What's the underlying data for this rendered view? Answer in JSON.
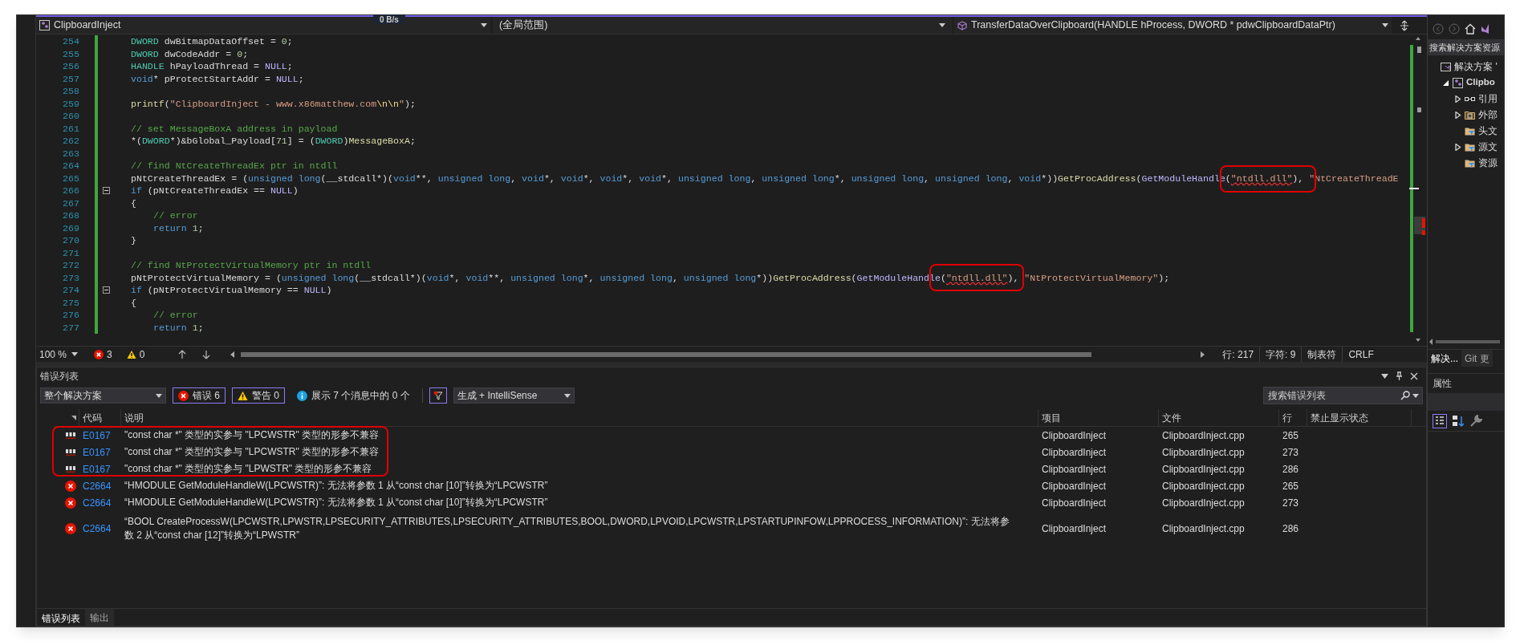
{
  "top_overlay": {
    "speed": "0 B/s"
  },
  "nav_bar": {
    "project": "ClipboardInject",
    "scope": "(全局范围)",
    "member": "TransferDataOverClipboard(HANDLE hProcess, DWORD * pdwClipboardDataPtr)"
  },
  "code_lines": [
    {
      "number": "254",
      "fold": false,
      "inner": false,
      "tokens": [
        {
          "text": "DWORD",
          "kind": "type"
        },
        {
          "text": " dwBitmapDataOffset = ",
          "kind": "plain"
        },
        {
          "text": "0",
          "kind": "number"
        },
        {
          "text": ";",
          "kind": "plain"
        }
      ]
    },
    {
      "number": "255",
      "fold": false,
      "inner": false,
      "tokens": [
        {
          "text": "DWORD",
          "kind": "type"
        },
        {
          "text": " dwCodeAddr = ",
          "kind": "plain"
        },
        {
          "text": "0",
          "kind": "number"
        },
        {
          "text": ";",
          "kind": "plain"
        }
      ]
    },
    {
      "number": "256",
      "fold": false,
      "inner": false,
      "tokens": [
        {
          "text": "HANDLE",
          "kind": "type"
        },
        {
          "text": " hPayloadThread = ",
          "kind": "plain"
        },
        {
          "text": "NULL",
          "kind": "macro"
        },
        {
          "text": ";",
          "kind": "plain"
        }
      ]
    },
    {
      "number": "257",
      "fold": false,
      "inner": false,
      "tokens": [
        {
          "text": "void",
          "kind": "keyword"
        },
        {
          "text": "* pProtectStartAddr = ",
          "kind": "plain"
        },
        {
          "text": "NULL",
          "kind": "macro"
        },
        {
          "text": ";",
          "kind": "plain"
        }
      ]
    },
    {
      "number": "258",
      "fold": false
    },
    {
      "number": "259",
      "fold": false,
      "inner": false,
      "tokens": [
        {
          "text": "printf",
          "kind": "func"
        },
        {
          "text": "(",
          "kind": "plain"
        },
        {
          "text": "\"ClipboardInject - www.x86matthew.com",
          "kind": "string"
        },
        {
          "text": "\\n\\n",
          "kind": "escape"
        },
        {
          "text": "\"",
          "kind": "string"
        },
        {
          "text": ");",
          "kind": "plain"
        }
      ]
    },
    {
      "number": "260",
      "fold": false
    },
    {
      "number": "261",
      "fold": false,
      "inner": false,
      "tokens": [
        {
          "text": "// set MessageBoxA address in payload",
          "kind": "comment"
        }
      ]
    },
    {
      "number": "262",
      "fold": false,
      "inner": false,
      "tokens": [
        {
          "text": "*(",
          "kind": "plain"
        },
        {
          "text": "DWORD",
          "kind": "type"
        },
        {
          "text": "*)&bGlobal_Payload[",
          "kind": "plain"
        },
        {
          "text": "71",
          "kind": "number"
        },
        {
          "text": "] = (",
          "kind": "plain"
        },
        {
          "text": "DWORD",
          "kind": "type"
        },
        {
          "text": ")",
          "kind": "plain"
        },
        {
          "text": "MessageBoxA",
          "kind": "func"
        },
        {
          "text": ";",
          "kind": "plain"
        }
      ]
    },
    {
      "number": "263",
      "fold": false
    },
    {
      "number": "264",
      "fold": false,
      "inner": false,
      "tokens": [
        {
          "text": "// find NtCreateThreadEx ptr in ntdll",
          "kind": "comment"
        }
      ]
    },
    {
      "number": "265",
      "fold": false,
      "inner": false,
      "tokens": [
        {
          "text": "pNtCreateThreadEx = (",
          "kind": "plain"
        },
        {
          "text": "unsigned long",
          "kind": "keyword"
        },
        {
          "text": "(__stdcall*)(",
          "kind": "plain"
        },
        {
          "text": "void",
          "kind": "keyword"
        },
        {
          "text": "**, ",
          "kind": "plain"
        },
        {
          "text": "unsigned long",
          "kind": "keyword"
        },
        {
          "text": ", ",
          "kind": "plain"
        },
        {
          "text": "void",
          "kind": "keyword"
        },
        {
          "text": "*, ",
          "kind": "plain"
        },
        {
          "text": "void",
          "kind": "keyword"
        },
        {
          "text": "*, ",
          "kind": "plain"
        },
        {
          "text": "void",
          "kind": "keyword"
        },
        {
          "text": "*, ",
          "kind": "plain"
        },
        {
          "text": "void",
          "kind": "keyword"
        },
        {
          "text": "*, ",
          "kind": "plain"
        },
        {
          "text": "unsigned long",
          "kind": "keyword"
        },
        {
          "text": ", ",
          "kind": "plain"
        },
        {
          "text": "unsigned long",
          "kind": "keyword"
        },
        {
          "text": "*, ",
          "kind": "plain"
        },
        {
          "text": "unsigned long",
          "kind": "keyword"
        },
        {
          "text": ", ",
          "kind": "plain"
        },
        {
          "text": "unsigned long",
          "kind": "keyword"
        },
        {
          "text": ", ",
          "kind": "plain"
        },
        {
          "text": "void",
          "kind": "keyword"
        },
        {
          "text": "*))",
          "kind": "plain"
        },
        {
          "text": "GetProcAddress",
          "kind": "func"
        },
        {
          "text": "(",
          "kind": "plain"
        },
        {
          "text": "GetModuleHandle",
          "kind": "macro"
        },
        {
          "text": "(",
          "kind": "plain"
        },
        {
          "text": "\"ntdll.dll\"",
          "kind": "bad-string"
        },
        {
          "text": "), ",
          "kind": "plain"
        },
        {
          "text": "\"NtCreateThreadE",
          "kind": "string"
        }
      ]
    },
    {
      "number": "266",
      "fold": true,
      "inner": false,
      "tokens": [
        {
          "text": "if",
          "kind": "keyword"
        },
        {
          "text": " (pNtCreateThreadEx == ",
          "kind": "plain"
        },
        {
          "text": "NULL",
          "kind": "macro"
        },
        {
          "text": ")",
          "kind": "plain"
        }
      ]
    },
    {
      "number": "267",
      "fold": false,
      "inner": false,
      "tokens": [
        {
          "text": "{",
          "kind": "plain"
        }
      ]
    },
    {
      "number": "268",
      "fold": false,
      "inner": true,
      "tokens": [
        {
          "text": "// error",
          "kind": "comment"
        }
      ]
    },
    {
      "number": "269",
      "fold": false,
      "inner": true,
      "tokens": [
        {
          "text": "return ",
          "kind": "keyword"
        },
        {
          "text": "1",
          "kind": "number"
        },
        {
          "text": ";",
          "kind": "plain"
        }
      ]
    },
    {
      "number": "270",
      "fold": false,
      "inner": false,
      "tokens": [
        {
          "text": "}",
          "kind": "plain"
        }
      ]
    },
    {
      "number": "271",
      "fold": false
    },
    {
      "number": "272",
      "fold": false,
      "inner": false,
      "tokens": [
        {
          "text": "// find NtProtectVirtualMemory ptr in ntdll",
          "kind": "comment"
        }
      ]
    },
    {
      "number": "273",
      "fold": false,
      "inner": false,
      "tokens": [
        {
          "text": "pNtProtectVirtualMemory = (",
          "kind": "plain"
        },
        {
          "text": "unsigned long",
          "kind": "keyword"
        },
        {
          "text": "(__stdcall*)(",
          "kind": "plain"
        },
        {
          "text": "void",
          "kind": "keyword"
        },
        {
          "text": "*, ",
          "kind": "plain"
        },
        {
          "text": "void",
          "kind": "keyword"
        },
        {
          "text": "**, ",
          "kind": "plain"
        },
        {
          "text": "unsigned long",
          "kind": "keyword"
        },
        {
          "text": "*, ",
          "kind": "plain"
        },
        {
          "text": "unsigned long",
          "kind": "keyword"
        },
        {
          "text": ", ",
          "kind": "plain"
        },
        {
          "text": "unsigned long",
          "kind": "keyword"
        },
        {
          "text": "*))",
          "kind": "plain"
        },
        {
          "text": "GetProcAddress",
          "kind": "func"
        },
        {
          "text": "(",
          "kind": "plain"
        },
        {
          "text": "GetModuleHandle",
          "kind": "macro"
        },
        {
          "text": "(",
          "kind": "plain"
        },
        {
          "text": "\"ntdll.dll\"",
          "kind": "bad-string"
        },
        {
          "text": "), ",
          "kind": "plain"
        },
        {
          "text": "\"NtProtectVirtualMemory\"",
          "kind": "string"
        },
        {
          "text": ");",
          "kind": "plain"
        }
      ]
    },
    {
      "number": "274",
      "fold": true,
      "inner": false,
      "tokens": [
        {
          "text": "if",
          "kind": "keyword"
        },
        {
          "text": " (pNtProtectVirtualMemory == ",
          "kind": "plain"
        },
        {
          "text": "NULL",
          "kind": "macro"
        },
        {
          "text": ")",
          "kind": "plain"
        }
      ]
    },
    {
      "number": "275",
      "fold": false,
      "inner": false,
      "tokens": [
        {
          "text": "{",
          "kind": "plain"
        }
      ]
    },
    {
      "number": "276",
      "fold": false,
      "inner": true,
      "tokens": [
        {
          "text": "// error",
          "kind": "comment"
        }
      ]
    },
    {
      "number": "277",
      "fold": false,
      "inner": true,
      "tokens": [
        {
          "text": "return ",
          "kind": "keyword"
        },
        {
          "text": "1",
          "kind": "number"
        },
        {
          "text": ";",
          "kind": "plain"
        }
      ]
    }
  ],
  "editor_status": {
    "zoom": "100 %",
    "errors": "3",
    "warnings": "0",
    "line": "行: 217",
    "column": "字符: 9",
    "indent": "制表符",
    "line_ending": "CRLF"
  },
  "error_list": {
    "title": "错误列表",
    "scope": "整个解决方案",
    "filters": [
      {
        "kind": "error",
        "label": "错误 6",
        "selected": true
      },
      {
        "kind": "warning",
        "label": "警告 0",
        "selected": true
      },
      {
        "kind": "info",
        "label": "展示 7 个消息中的 0 个",
        "selected": false
      }
    ],
    "filter_button": {
      "on": true
    },
    "source": "生成 + IntelliSense",
    "search": {
      "placeholder": "搜索错误列表"
    },
    "columns": [
      "代码",
      "说明",
      "项目",
      "文件",
      "行",
      "禁止显示状态"
    ],
    "rows": [
      {
        "kind": "intellisense",
        "code": "E0167",
        "description": "\"const char *\" 类型的实参与 \"LPCWSTR\" 类型的形参不兼容",
        "project": "ClipboardInject",
        "file": "ClipboardInject.cpp",
        "line": "265"
      },
      {
        "kind": "intellisense",
        "code": "E0167",
        "description": "\"const char *\" 类型的实参与 \"LPCWSTR\" 类型的形参不兼容",
        "project": "ClipboardInject",
        "file": "ClipboardInject.cpp",
        "line": "273"
      },
      {
        "kind": "intellisense",
        "code": "E0167",
        "description": "\"const char *\" 类型的实参与 \"LPWSTR\" 类型的形参不兼容",
        "project": "ClipboardInject",
        "file": "ClipboardInject.cpp",
        "line": "286"
      },
      {
        "kind": "error",
        "code": "C2664",
        "description": "“HMODULE GetModuleHandleW(LPCWSTR)”: 无法将参数 1 从“const char [10]”转换为“LPCWSTR”",
        "project": "ClipboardInject",
        "file": "ClipboardInject.cpp",
        "line": "265"
      },
      {
        "kind": "error",
        "code": "C2664",
        "description": "“HMODULE GetModuleHandleW(LPCWSTR)”: 无法将参数 1 从“const char [10]”转换为“LPCWSTR”",
        "project": "ClipboardInject",
        "file": "ClipboardInject.cpp",
        "line": "273"
      },
      {
        "kind": "error",
        "code": "C2664",
        "description": "“BOOL CreateProcessW(LPCWSTR,LPWSTR,LPSECURITY_ATTRIBUTES,LPSECURITY_ATTRIBUTES,BOOL,DWORD,LPVOID,LPCWSTR,LPSTARTUPINFOW,LPPROCESS_INFORMATION)”: 无法将参数 2 从“const char [12]”转换为“LPWSTR”",
        "project": "ClipboardInject",
        "file": "ClipboardInject.cpp",
        "line": "286"
      }
    ]
  },
  "bottom_tabs": [
    {
      "label": "错误列表",
      "selected": true
    },
    {
      "label": "输出",
      "selected": false
    }
  ],
  "solution_explorer": {
    "search": {
      "placeholder": "搜索解决方案资源"
    },
    "tree": [
      {
        "label": "解决方案 '",
        "kind": "solution",
        "expandable": false,
        "children": [
          {
            "label": "Clipbo",
            "kind": "project",
            "expandable": true,
            "expanded": true,
            "children": [
              {
                "label": "引用",
                "kind": "references",
                "expandable": true,
                "expanded": false
              },
              {
                "label": "外部",
                "kind": "external",
                "expandable": true,
                "expanded": false
              },
              {
                "label": "头文",
                "kind": "filter",
                "expandable": false
              },
              {
                "label": "源文",
                "kind": "filter",
                "expandable": true,
                "expanded": false
              },
              {
                "label": "资源",
                "kind": "filter",
                "expandable": false
              }
            ]
          }
        ]
      }
    ],
    "tabs": [
      {
        "label": "解决...",
        "selected": true
      },
      {
        "label": "Git 更",
        "selected": false
      }
    ]
  },
  "properties": {
    "title": "属性"
  }
}
